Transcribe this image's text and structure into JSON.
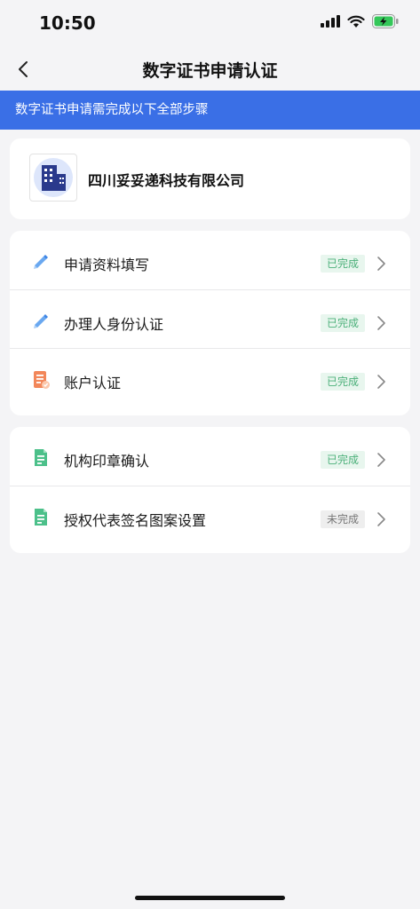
{
  "status_bar": {
    "time": "10:50",
    "battery_color": "#34c759"
  },
  "nav": {
    "title": "数字证书申请认证",
    "back_icon": "chevron-left-icon"
  },
  "notice": {
    "text": "数字证书申请需完成以下全部步骤",
    "background": "#3a6fe6"
  },
  "company": {
    "name": "四川妥妥递科技有限公司",
    "logo_icon": "building-icon"
  },
  "steps_group_1": [
    {
      "label": "申请资料填写",
      "status": "已完成",
      "icon": "pencil-icon"
    },
    {
      "label": "办理人身份认证",
      "status": "已完成",
      "icon": "pencil-icon"
    },
    {
      "label": "账户认证",
      "status": "已完成",
      "icon": "document-check-icon"
    }
  ],
  "steps_group_2": [
    {
      "label": "机构印章确认",
      "status": "已完成",
      "icon": "document-icon"
    },
    {
      "label": "授权代表签名图案设置",
      "status": "未完成",
      "icon": "document-icon"
    }
  ],
  "colors": {
    "done_text": "#4cb07a",
    "done_bg": "#e8f6ee",
    "todo_text": "#777777",
    "todo_bg": "#eeeeee"
  }
}
